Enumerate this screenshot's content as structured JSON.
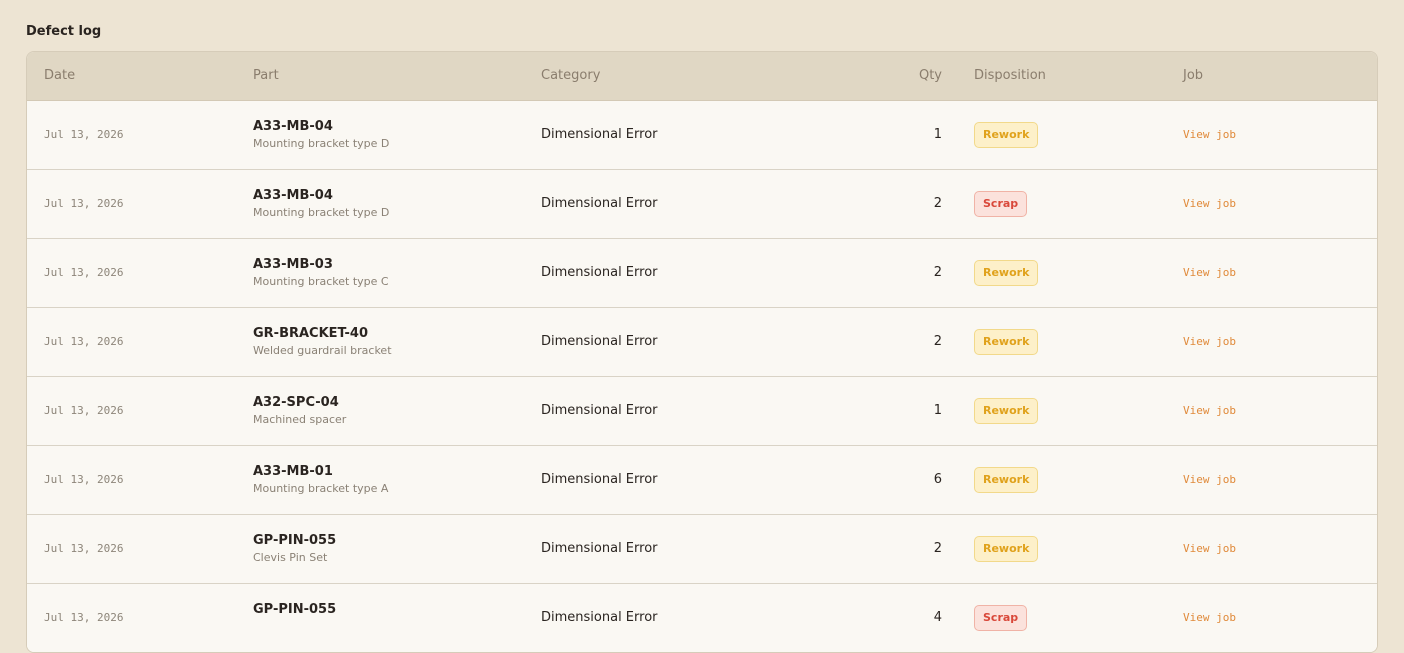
{
  "title": "Defect log",
  "columns": {
    "date": "Date",
    "part": "Part",
    "category": "Category",
    "qty": "Qty",
    "disposition": "Disposition",
    "job": "Job"
  },
  "colors": {
    "rework_text": "#e0a21c",
    "scrap_text": "#d9483a",
    "link": "#e08a3a"
  },
  "rows": [
    {
      "date": "Jul 13, 2026",
      "part_code": "A33-MB-04",
      "part_desc": "Mounting bracket type D",
      "category": "Dimensional Error",
      "qty": "1",
      "disposition": "Rework",
      "job": "View job"
    },
    {
      "date": "Jul 13, 2026",
      "part_code": "A33-MB-04",
      "part_desc": "Mounting bracket type D",
      "category": "Dimensional Error",
      "qty": "2",
      "disposition": "Scrap",
      "job": "View job"
    },
    {
      "date": "Jul 13, 2026",
      "part_code": "A33-MB-03",
      "part_desc": "Mounting bracket type C",
      "category": "Dimensional Error",
      "qty": "2",
      "disposition": "Rework",
      "job": "View job"
    },
    {
      "date": "Jul 13, 2026",
      "part_code": "GR-BRACKET-40",
      "part_desc": "Welded guardrail bracket",
      "category": "Dimensional Error",
      "qty": "2",
      "disposition": "Rework",
      "job": "View job"
    },
    {
      "date": "Jul 13, 2026",
      "part_code": "A32-SPC-04",
      "part_desc": "Machined spacer",
      "category": "Dimensional Error",
      "qty": "1",
      "disposition": "Rework",
      "job": "View job"
    },
    {
      "date": "Jul 13, 2026",
      "part_code": "A33-MB-01",
      "part_desc": "Mounting bracket type A",
      "category": "Dimensional Error",
      "qty": "6",
      "disposition": "Rework",
      "job": "View job"
    },
    {
      "date": "Jul 13, 2026",
      "part_code": "GP-PIN-055",
      "part_desc": "Clevis Pin Set",
      "category": "Dimensional Error",
      "qty": "2",
      "disposition": "Rework",
      "job": "View job"
    },
    {
      "date": "Jul 13, 2026",
      "part_code": "GP-PIN-055",
      "part_desc": "",
      "category": "Dimensional Error",
      "qty": "4",
      "disposition": "Scrap",
      "job": "View job"
    }
  ]
}
